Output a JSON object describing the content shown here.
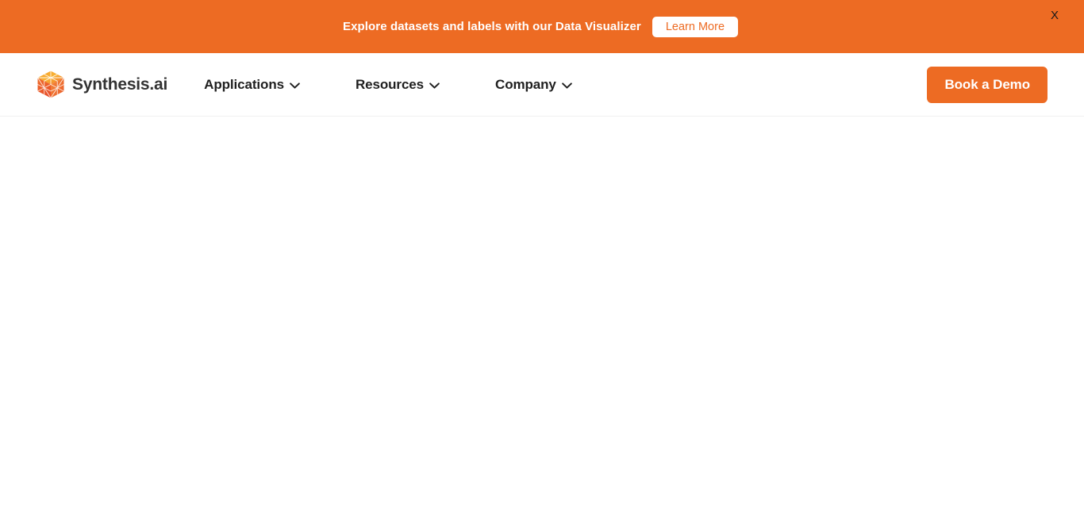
{
  "announcement": {
    "message": "Explore datasets and labels with our Data Visualizer",
    "cta_label": "Learn More",
    "close_label": "X",
    "background_color": "#ED6B23",
    "cta_background_color": "#FFFFFF",
    "cta_text_color": "#ED6B23"
  },
  "header": {
    "brand": {
      "name": "Synthesis.ai",
      "logo_icon": "synthesis-cube-logo-icon",
      "text_color": "#333333"
    },
    "nav_items": [
      {
        "label": "Applications",
        "icon": "chevron-down-icon"
      },
      {
        "label": "Resources",
        "icon": "chevron-down-icon"
      },
      {
        "label": "Company",
        "icon": "chevron-down-icon"
      }
    ],
    "cta": {
      "label": "Book a Demo",
      "background_color": "#ED6B23",
      "text_color": "#FFFFFF"
    },
    "background_color": "#FFFFFF",
    "border_color": "#F0F0F0"
  },
  "page": {
    "body_background_color": "#FFFFFF",
    "content": ""
  }
}
